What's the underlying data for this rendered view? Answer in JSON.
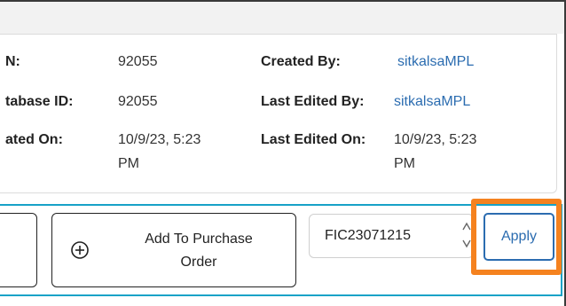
{
  "info": {
    "number_label": "N:",
    "number_value": "92055",
    "database_id_label": "tabase ID:",
    "database_id_value": "92055",
    "created_on_label": "ated On:",
    "created_on_value_line1": "10/9/23, 5:23",
    "created_on_value_line2": "PM",
    "created_by_label": "Created By:",
    "created_by_value": "sitkalsaMPL",
    "last_edited_by_label": "Last Edited By:",
    "last_edited_by_value": "sitkalsaMPL",
    "last_edited_on_label": "Last Edited On:",
    "last_edited_on_value_line1": "10/9/23, 5:23",
    "last_edited_on_value_line2": "PM"
  },
  "actions": {
    "add_to_po_line1": "Add To Purchase",
    "add_to_po_line2": "Order",
    "po_number_value": "FIC23071215",
    "apply_label": "Apply"
  },
  "colors": {
    "accent_blue": "#2b6cb0",
    "highlight_orange": "#f5821f",
    "action_bar_border": "#17a2c7"
  },
  "icons": {
    "add": "plus-circle-icon",
    "stepper": "spinner-arrows-icon"
  }
}
